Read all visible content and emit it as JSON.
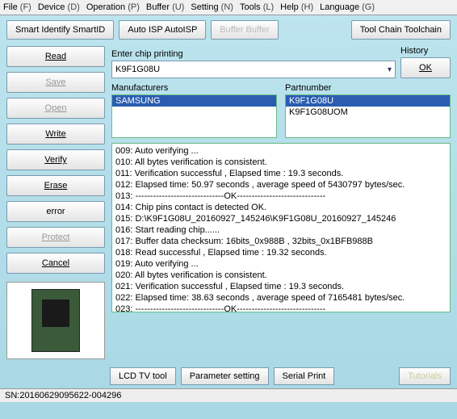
{
  "menu": {
    "items": [
      {
        "label": "File",
        "key": "(F)"
      },
      {
        "label": "Device",
        "key": "(D)"
      },
      {
        "label": "Operation",
        "key": "(P)"
      },
      {
        "label": "Buffer",
        "key": "(U)"
      },
      {
        "label": "Setting",
        "key": "(N)"
      },
      {
        "label": "Tools",
        "key": "(L)"
      },
      {
        "label": "Help",
        "key": "(H)"
      },
      {
        "label": "Language",
        "key": "(G)"
      }
    ]
  },
  "toolbar": {
    "smart": "Smart Identify SmartID",
    "autoisp": "Auto ISP AutoISP",
    "buffer": "Buffer Buffer",
    "toolchain": "Tool Chain Toolchain"
  },
  "left_buttons": {
    "read": "Read",
    "save": "Save",
    "open": "Open",
    "write": "Write",
    "verify": "Verify",
    "erase": "Erase",
    "error": "error",
    "protect": "Protect",
    "cancel": "Cancel"
  },
  "enter": {
    "label": "Enter chip printing",
    "value": "K9F1G08U",
    "history_label": "History",
    "ok": "OK"
  },
  "manufacturers": {
    "label": "Manufacturers",
    "items": [
      "SAMSUNG"
    ]
  },
  "partnumber": {
    "label": "Partnumber",
    "items": [
      "K9F1G08U",
      "K9F1G08UOM"
    ]
  },
  "log_lines": [
    "009:  Auto verifying ...",
    "010:  All bytes verification is consistent.",
    "011:  Verification successful , Elapsed time : 19.3 seconds.",
    "012:  Elapsed time: 50.97 seconds , average speed of 5430797 bytes/sec.",
    "013:  ------------------------------OK------------------------------",
    "014:  Chip pins contact is detected OK.",
    "015:  D:\\K9F1G08U_20160927_145246\\K9F1G08U_20160927_145246",
    "016:  Start reading chip......",
    "017:  Buffer data checksum: 16bits_0x988B , 32bits_0x1BFB988B",
    "018:  Read successful , Elapsed time : 19.32 seconds.",
    "019:  Auto verifying ...",
    "020:  All bytes verification is consistent.",
    "021:  Verification successful , Elapsed time : 19.3 seconds.",
    "022:  Elapsed time: 38.63 seconds , average speed of 7165481 bytes/sec.",
    "023:  ------------------------------OK------------------------------"
  ],
  "bottom": {
    "lcd": "LCD TV tool",
    "param": "Parameter setting",
    "serial": "Serial Print",
    "tutorials": "Tutorials"
  },
  "status": "SN:20160629095622-004296"
}
